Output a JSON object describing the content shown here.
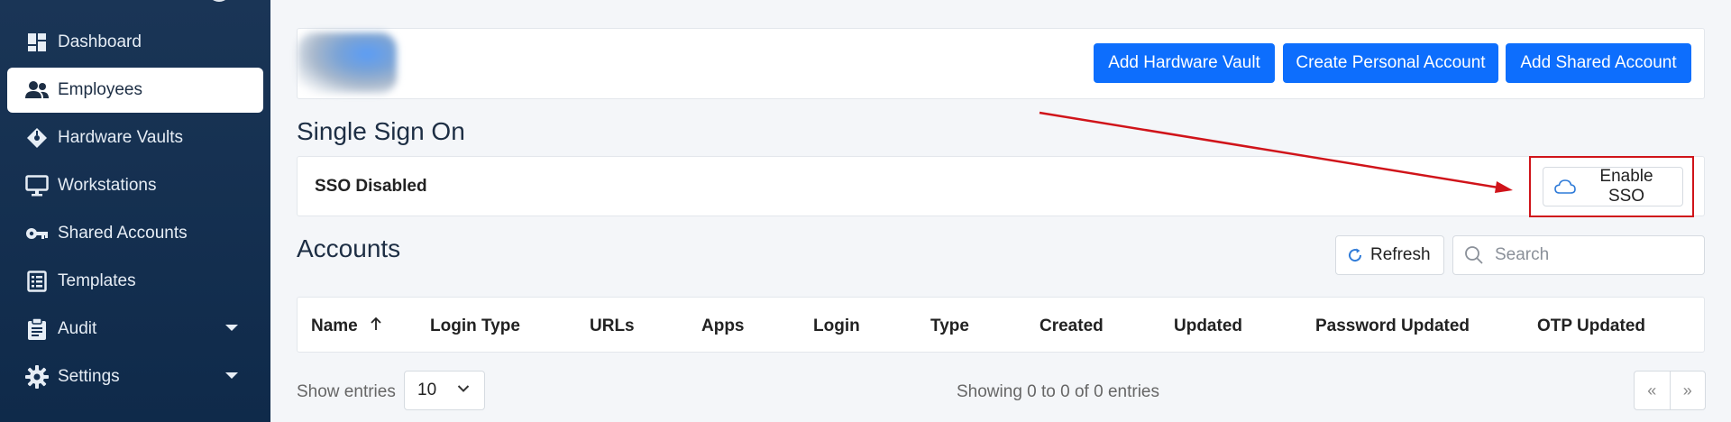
{
  "sidebar": {
    "items": [
      {
        "label": "Dashboard",
        "icon": "dashboard-icon"
      },
      {
        "label": "Employees",
        "icon": "users-icon",
        "active": true
      },
      {
        "label": "Hardware Vaults",
        "icon": "diamond-tag-icon"
      },
      {
        "label": "Workstations",
        "icon": "monitor-icon"
      },
      {
        "label": "Shared Accounts",
        "icon": "key-icon"
      },
      {
        "label": "Templates",
        "icon": "list-icon"
      },
      {
        "label": "Audit",
        "icon": "clipboard-icon",
        "has_submenu": true
      },
      {
        "label": "Settings",
        "icon": "gear-icon",
        "has_submenu": true
      }
    ]
  },
  "header": {
    "buttons": [
      "Add Hardware Vault",
      "Create Personal Account",
      "Add Shared Account"
    ]
  },
  "sso": {
    "title": "Single Sign On",
    "status": "SSO Disabled",
    "enable_label": "Enable SSO"
  },
  "accounts": {
    "title": "Accounts",
    "refresh_label": "Refresh",
    "search_placeholder": "Search",
    "columns": [
      "Name",
      "Login Type",
      "URLs",
      "Apps",
      "Login",
      "Type",
      "Created",
      "Updated",
      "Password Updated",
      "OTP Updated"
    ],
    "sort_column": "Name",
    "show_entries_label": "Show entries",
    "page_size": "10",
    "showing_text": "Showing 0 to 0 of 0 entries",
    "pager": {
      "prev": "«",
      "next": "»"
    }
  },
  "colors": {
    "primary": "#0d6efd",
    "sidebar": "#0f2a4a",
    "highlight": "#d0141a"
  }
}
